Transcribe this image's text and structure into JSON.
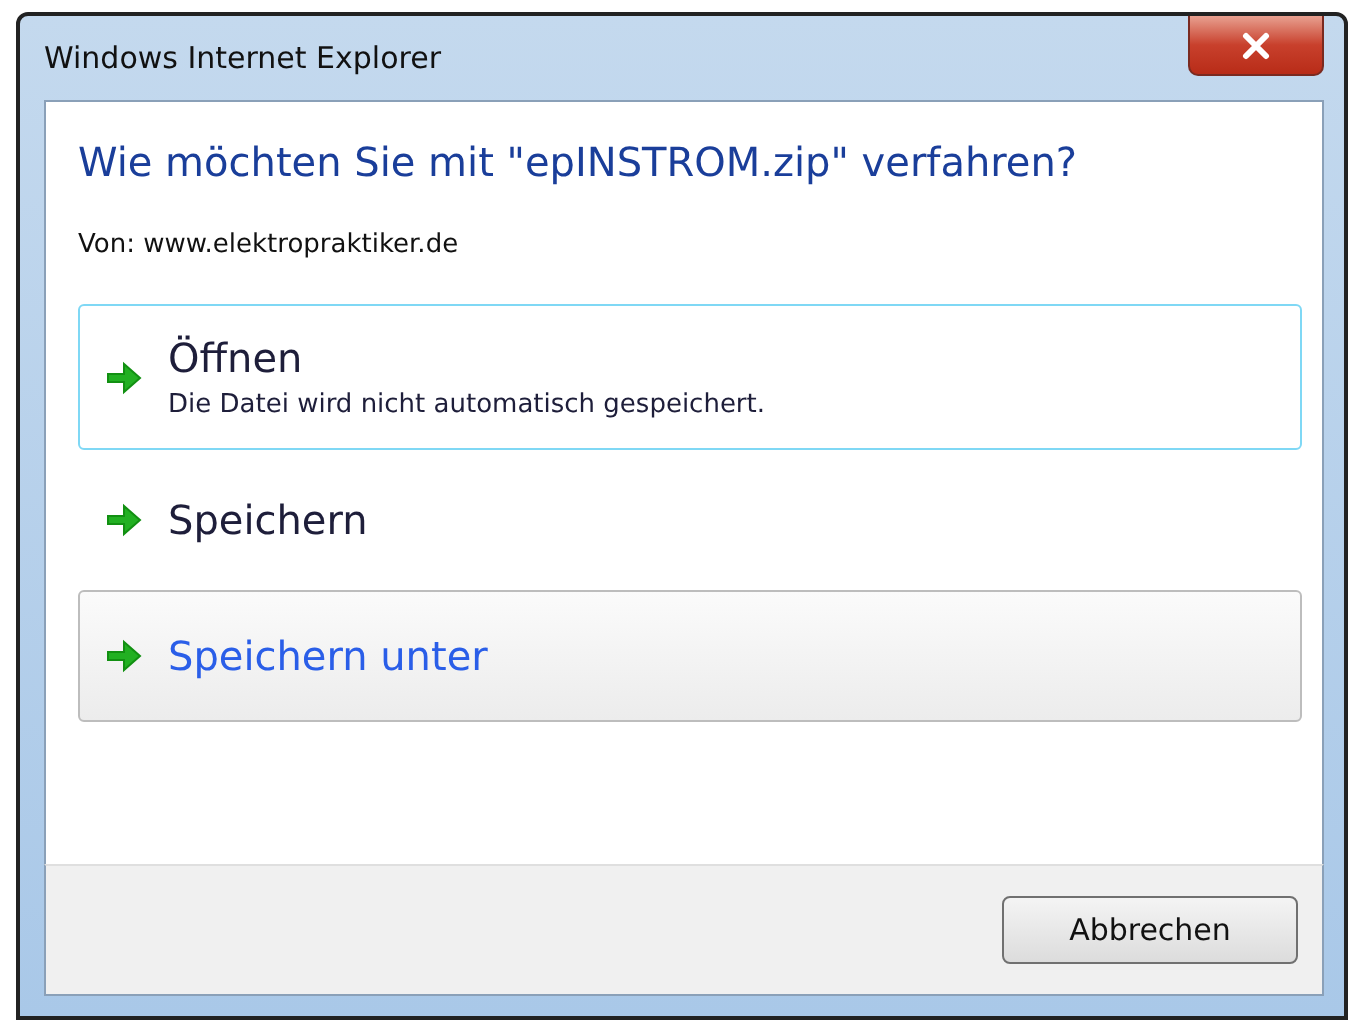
{
  "window": {
    "title": "Windows Internet Explorer"
  },
  "question": "Wie möchten Sie mit \"epINSTROM.zip\" verfahren?",
  "source": "Von: www.elektropraktiker.de",
  "options": [
    {
      "label": "Öffnen",
      "description": "Die Datei wird nicht automatisch gespeichert.",
      "focused": true,
      "hovered": false
    },
    {
      "label": "Speichern",
      "focused": false,
      "hovered": false
    },
    {
      "label": "Speichern unter",
      "focused": false,
      "hovered": true
    }
  ],
  "buttons": [
    "Abbrechen"
  ]
}
